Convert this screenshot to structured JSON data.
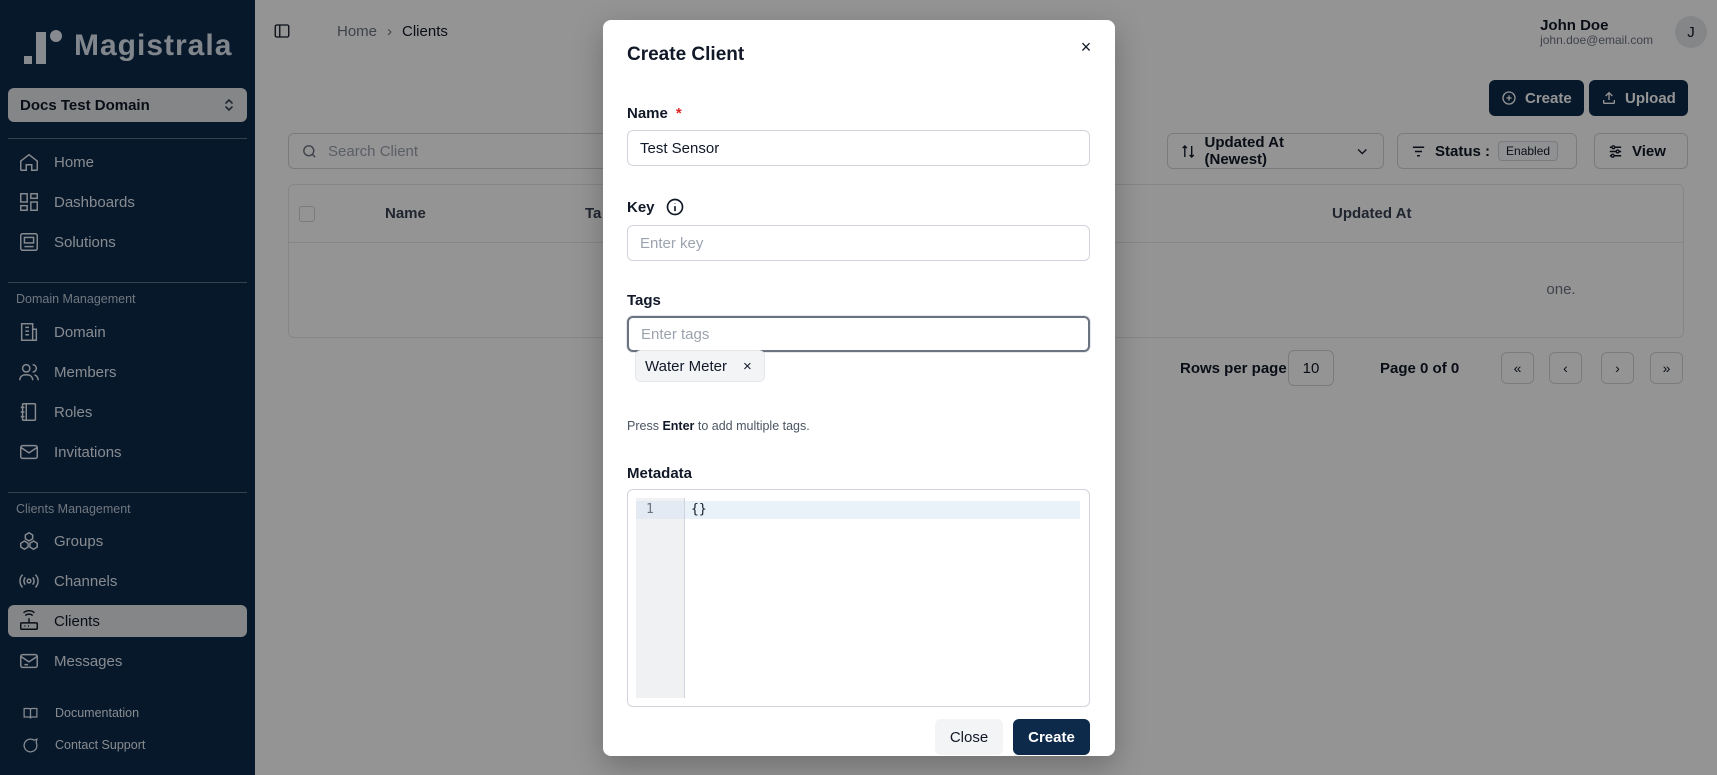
{
  "sidebar": {
    "logo_text": "Magistrala",
    "domain_selector": "Docs Test Domain",
    "nav_main": [
      {
        "label": "Home",
        "icon": "home-icon"
      },
      {
        "label": "Dashboards",
        "icon": "dashboard-icon"
      },
      {
        "label": "Solutions",
        "icon": "solutions-icon"
      }
    ],
    "section_domain": "Domain Management",
    "nav_domain": [
      {
        "label": "Domain",
        "icon": "building-icon"
      },
      {
        "label": "Members",
        "icon": "users-icon"
      },
      {
        "label": "Roles",
        "icon": "roles-icon"
      },
      {
        "label": "Invitations",
        "icon": "mail-icon"
      }
    ],
    "section_clients": "Clients Management",
    "nav_clients": [
      {
        "label": "Groups",
        "icon": "groups-icon"
      },
      {
        "label": "Channels",
        "icon": "broadcast-icon"
      },
      {
        "label": "Clients",
        "icon": "router-icon"
      },
      {
        "label": "Messages",
        "icon": "messages-icon"
      }
    ],
    "footer": [
      {
        "label": "Documentation",
        "icon": "book-icon"
      },
      {
        "label": "Contact Support",
        "icon": "chat-icon"
      }
    ]
  },
  "header": {
    "breadcrumb_home": "Home",
    "breadcrumb_current": "Clients",
    "user_name": "John Doe",
    "user_email": "john.doe@email.com",
    "avatar_initial": "J",
    "create_label": "Create",
    "upload_label": "Upload"
  },
  "toolbar": {
    "search_placeholder": "Search Client",
    "sort_label": "Updated At (Newest)",
    "status_label": "Status :",
    "status_value": "Enabled",
    "view_label": "View"
  },
  "table": {
    "col_name": "Name",
    "col_tags": "Ta",
    "col_updated": "Updated At",
    "empty_fragment": "one."
  },
  "pagination": {
    "rows_label": "Rows per page",
    "rows_value": "10",
    "page_label": "Page 0 of 0",
    "first": "«",
    "prev": "‹",
    "next": "›",
    "last": "»"
  },
  "modal": {
    "title": "Create Client",
    "close_x": "×",
    "name_label": "Name",
    "name_required": "*",
    "name_value": "Test Sensor",
    "key_label": "Key",
    "key_placeholder": "Enter key",
    "tags_label": "Tags",
    "tags_placeholder": "Enter tags",
    "tag_chip": "Water Meter",
    "tag_remove": "×",
    "hint_prefix": "Press ",
    "hint_key": "Enter",
    "hint_suffix": " to add multiple tags.",
    "metadata_label": "Metadata",
    "metadata_line_number": "1",
    "metadata_value": "{}",
    "close_button": "Close",
    "create_button": "Create"
  },
  "colors": {
    "sidebar_bg": "#0d2a4b",
    "primary": "#0d2a4b",
    "required": "#dc2626"
  }
}
